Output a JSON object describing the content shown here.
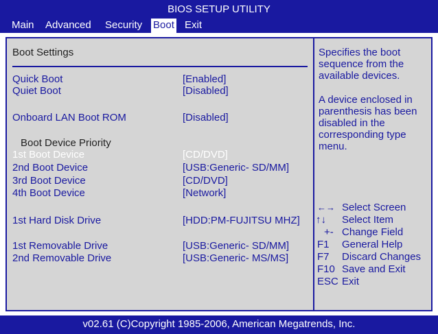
{
  "title": "BIOS SETUP UTILITY",
  "menu": [
    {
      "label": "Main"
    },
    {
      "label": "Advanced"
    },
    {
      "label": "Security"
    },
    {
      "label": "Boot"
    },
    {
      "label": "Exit"
    }
  ],
  "active_menu": "Boot",
  "section_title": "Boot Settings",
  "settings": {
    "quick_boot": {
      "label": "Quick Boot",
      "value": "[Enabled]"
    },
    "quiet_boot": {
      "label": "Quiet Boot",
      "value": "[Disabled]"
    },
    "onboard_lan": {
      "label": "Onboard LAN Boot ROM",
      "value": "[Disabled]"
    },
    "priority_header": "Boot Device Priority",
    "boot1": {
      "label": "1st Boot Device",
      "value": "[CD/DVD]"
    },
    "boot2": {
      "label": "2nd Boot Device",
      "value": "[USB:Generic- SD/MM]"
    },
    "boot3": {
      "label": "3rd Boot Device",
      "value": "[CD/DVD]"
    },
    "boot4": {
      "label": "4th Boot Device",
      "value": "[Network]"
    },
    "hdd1": {
      "label": "1st Hard Disk Drive",
      "value": "[HDD:PM-FUJITSU MHZ]"
    },
    "rem1": {
      "label": "1st Removable Drive",
      "value": "[USB:Generic- SD/MM]"
    },
    "rem2": {
      "label": "2nd Removable Drive",
      "value": "[USB:Generic- MS/MS]"
    }
  },
  "help": {
    "line1": "Specifies the boot",
    "line2": "sequence from the",
    "line3": "available devices.",
    "line4": "A device enclosed in",
    "line5": "parenthesis has been",
    "line6": "disabled in the",
    "line7": "corresponding type",
    "line8": "menu."
  },
  "keys": [
    {
      "key": "←→",
      "desc": "Select Screen"
    },
    {
      "key": "↑↓",
      "desc": "Select Item"
    },
    {
      "key": "+-",
      "desc": "Change Field"
    },
    {
      "key": "F1",
      "desc": "General Help"
    },
    {
      "key": "F7",
      "desc": "Discard Changes"
    },
    {
      "key": "F10",
      "desc": "Save and Exit"
    },
    {
      "key": "ESC",
      "desc": "Exit"
    }
  ],
  "footer": "v02.61  (C)Copyright 1985-2006, American Megatrends, Inc.",
  "colors": {
    "bios_blue": "#1919a0",
    "panel_gray": "#d5d5d5",
    "selected_text": "#ffffff"
  }
}
